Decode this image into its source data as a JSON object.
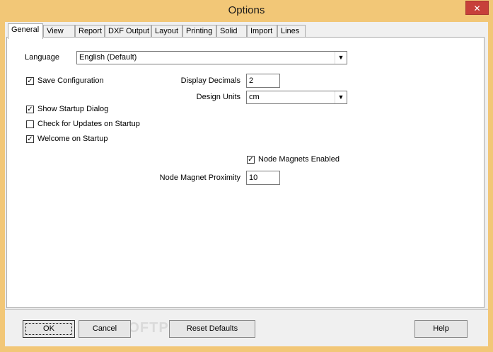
{
  "window": {
    "title": "Options",
    "close_glyph": "✕"
  },
  "tabs": [
    {
      "label": "General"
    },
    {
      "label": "View"
    },
    {
      "label": "Report"
    },
    {
      "label": "DXF Output"
    },
    {
      "label": "Layout"
    },
    {
      "label": "Printing"
    },
    {
      "label": "Solid"
    },
    {
      "label": "Import"
    },
    {
      "label": "Lines"
    }
  ],
  "general": {
    "language_label": "Language",
    "language_value": "English (Default)",
    "save_configuration": {
      "label": "Save Configuration",
      "checked": true
    },
    "show_startup_dialog": {
      "label": "Show Startup Dialog",
      "checked": true
    },
    "check_updates": {
      "label": "Check for Updates on Startup",
      "checked": false
    },
    "welcome_startup": {
      "label": "Welcome on Startup",
      "checked": true
    },
    "display_decimals_label": "Display Decimals",
    "display_decimals_value": "2",
    "design_units_label": "Design Units",
    "design_units_value": "cm",
    "node_magnets": {
      "label": "Node Magnets Enabled",
      "checked": true
    },
    "node_magnet_proximity_label": "Node Magnet Proximity",
    "node_magnet_proximity_value": "10",
    "check_glyph": "✓",
    "dropdown_glyph": "▼"
  },
  "buttons": {
    "ok": "OK",
    "cancel": "Cancel",
    "reset_defaults": "Reset Defaults",
    "help": "Help"
  },
  "watermark": "SOFTPEDIA",
  "colors": {
    "titlebar": "#f2c777",
    "close": "#c7403a",
    "client": "#f0f0f0"
  }
}
